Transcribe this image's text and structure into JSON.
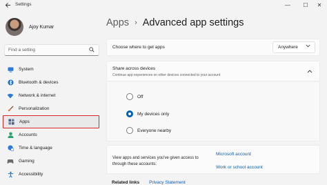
{
  "window": {
    "title": "Settings",
    "back_icon": "back-arrow-icon",
    "minimize_glyph": "—",
    "maximize_glyph": "☐",
    "close_glyph": "✕"
  },
  "profile": {
    "name": "Ajoy Kumar"
  },
  "search": {
    "placeholder": "Find a setting"
  },
  "sidebar": {
    "items": [
      {
        "label": "System",
        "icon": "system-icon",
        "color": "#2b79d8"
      },
      {
        "label": "Bluetooth & devices",
        "icon": "bluetooth-icon",
        "color": "#1f6fd0"
      },
      {
        "label": "Network & internet",
        "icon": "network-icon",
        "color": "#2b79d8"
      },
      {
        "label": "Personalization",
        "icon": "paintbrush-icon",
        "color": "#d86b2a"
      },
      {
        "label": "Apps",
        "icon": "apps-icon",
        "color": "#4a5a8a",
        "active": true
      },
      {
        "label": "Accounts",
        "icon": "accounts-icon",
        "color": "#2aa36b"
      },
      {
        "label": "Time & language",
        "icon": "clock-globe-icon",
        "color": "#2b79d8"
      },
      {
        "label": "Gaming",
        "icon": "gaming-icon",
        "color": "#6b6b6b"
      },
      {
        "label": "Accessibility",
        "icon": "accessibility-icon",
        "color": "#1f6fd0"
      }
    ]
  },
  "breadcrumb": {
    "parent": "Apps",
    "separator": "›",
    "current": "Advanced app settings"
  },
  "choose_apps": {
    "label": "Choose where to get apps",
    "value": "Anywhere"
  },
  "share": {
    "title": "Share across devices",
    "subtitle": "Continue app experiences on other devices connected to your account",
    "options": [
      {
        "label": "Off",
        "checked": false
      },
      {
        "label": "My devices only",
        "checked": true
      },
      {
        "label": "Everyone nearby",
        "checked": false
      }
    ]
  },
  "account_links": {
    "description": "View apps and services you've given access to through these accounts:",
    "links": [
      "Microsoft account",
      "Work or school account"
    ]
  },
  "related": {
    "label": "Related links",
    "link": "Privacy Statement"
  },
  "colors": {
    "accent": "#0060b8",
    "link": "#0b5fb5",
    "highlight_border": "#d6262c"
  }
}
